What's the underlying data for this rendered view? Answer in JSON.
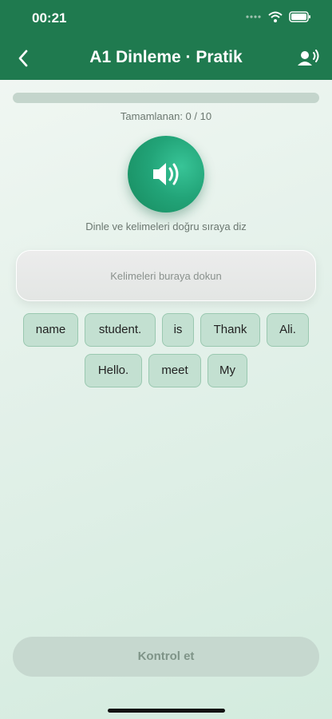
{
  "status": {
    "time": "00:21"
  },
  "header": {
    "title": "A1 Dinleme · Pratik"
  },
  "progress": {
    "completed_label": "Tamamlanan: 0 / 10",
    "fraction": 0
  },
  "player": {
    "instruction": "Dinle ve kelimeleri doğru sıraya diz"
  },
  "answer": {
    "placeholder": "Kelimeleri buraya dokun"
  },
  "words": [
    "name",
    "student.",
    "is",
    "Thank",
    "Ali.",
    "Hello.",
    "meet",
    "My"
  ],
  "check_button": {
    "label": "Kontrol et"
  },
  "colors": {
    "brand": "#1f7a4f",
    "chip_bg": "#c3e0d1",
    "accent": "#22a478"
  },
  "icons": [
    "back-chevron-icon",
    "speaker-person-icon",
    "speaker-icon",
    "wifi-icon",
    "battery-icon",
    "signal-icon"
  ]
}
